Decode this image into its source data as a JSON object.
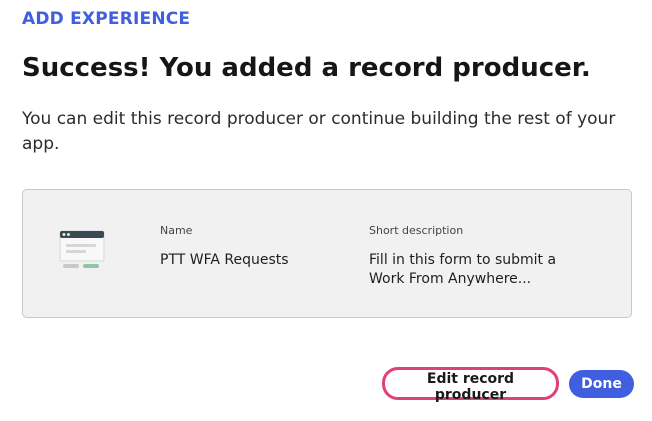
{
  "header": {
    "eyebrow": "ADD EXPERIENCE",
    "title": "Success! You added a record producer.",
    "description": "You can edit this record producer or continue building the rest of your app."
  },
  "card": {
    "icon": "form-icon",
    "name_label": "Name",
    "name_value": "PTT WFA Requests",
    "short_description_label": "Short description",
    "short_description_value": "Fill in this form to submit a Work From Anywhere..."
  },
  "actions": {
    "edit_label": "Edit record producer",
    "done_label": "Done"
  },
  "colors": {
    "accent": "#3f5ee0",
    "focus_ring": "#e0407a"
  }
}
